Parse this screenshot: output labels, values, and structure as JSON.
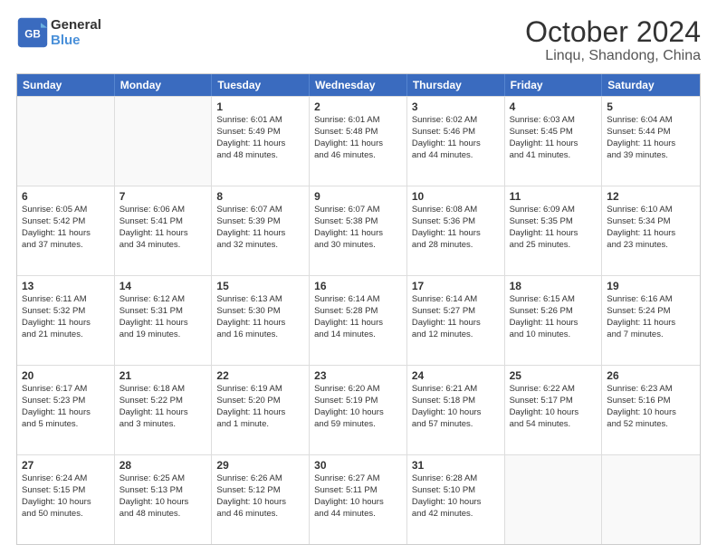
{
  "header": {
    "logo_line1": "General",
    "logo_line2": "Blue",
    "month": "October 2024",
    "location": "Linqu, Shandong, China"
  },
  "weekdays": [
    "Sunday",
    "Monday",
    "Tuesday",
    "Wednesday",
    "Thursday",
    "Friday",
    "Saturday"
  ],
  "rows": [
    [
      {
        "day": "",
        "lines": [],
        "empty": true
      },
      {
        "day": "",
        "lines": [],
        "empty": true
      },
      {
        "day": "1",
        "lines": [
          "Sunrise: 6:01 AM",
          "Sunset: 5:49 PM",
          "Daylight: 11 hours",
          "and 48 minutes."
        ]
      },
      {
        "day": "2",
        "lines": [
          "Sunrise: 6:01 AM",
          "Sunset: 5:48 PM",
          "Daylight: 11 hours",
          "and 46 minutes."
        ]
      },
      {
        "day": "3",
        "lines": [
          "Sunrise: 6:02 AM",
          "Sunset: 5:46 PM",
          "Daylight: 11 hours",
          "and 44 minutes."
        ]
      },
      {
        "day": "4",
        "lines": [
          "Sunrise: 6:03 AM",
          "Sunset: 5:45 PM",
          "Daylight: 11 hours",
          "and 41 minutes."
        ]
      },
      {
        "day": "5",
        "lines": [
          "Sunrise: 6:04 AM",
          "Sunset: 5:44 PM",
          "Daylight: 11 hours",
          "and 39 minutes."
        ]
      }
    ],
    [
      {
        "day": "6",
        "lines": [
          "Sunrise: 6:05 AM",
          "Sunset: 5:42 PM",
          "Daylight: 11 hours",
          "and 37 minutes."
        ]
      },
      {
        "day": "7",
        "lines": [
          "Sunrise: 6:06 AM",
          "Sunset: 5:41 PM",
          "Daylight: 11 hours",
          "and 34 minutes."
        ]
      },
      {
        "day": "8",
        "lines": [
          "Sunrise: 6:07 AM",
          "Sunset: 5:39 PM",
          "Daylight: 11 hours",
          "and 32 minutes."
        ]
      },
      {
        "day": "9",
        "lines": [
          "Sunrise: 6:07 AM",
          "Sunset: 5:38 PM",
          "Daylight: 11 hours",
          "and 30 minutes."
        ]
      },
      {
        "day": "10",
        "lines": [
          "Sunrise: 6:08 AM",
          "Sunset: 5:36 PM",
          "Daylight: 11 hours",
          "and 28 minutes."
        ]
      },
      {
        "day": "11",
        "lines": [
          "Sunrise: 6:09 AM",
          "Sunset: 5:35 PM",
          "Daylight: 11 hours",
          "and 25 minutes."
        ]
      },
      {
        "day": "12",
        "lines": [
          "Sunrise: 6:10 AM",
          "Sunset: 5:34 PM",
          "Daylight: 11 hours",
          "and 23 minutes."
        ]
      }
    ],
    [
      {
        "day": "13",
        "lines": [
          "Sunrise: 6:11 AM",
          "Sunset: 5:32 PM",
          "Daylight: 11 hours",
          "and 21 minutes."
        ]
      },
      {
        "day": "14",
        "lines": [
          "Sunrise: 6:12 AM",
          "Sunset: 5:31 PM",
          "Daylight: 11 hours",
          "and 19 minutes."
        ]
      },
      {
        "day": "15",
        "lines": [
          "Sunrise: 6:13 AM",
          "Sunset: 5:30 PM",
          "Daylight: 11 hours",
          "and 16 minutes."
        ]
      },
      {
        "day": "16",
        "lines": [
          "Sunrise: 6:14 AM",
          "Sunset: 5:28 PM",
          "Daylight: 11 hours",
          "and 14 minutes."
        ]
      },
      {
        "day": "17",
        "lines": [
          "Sunrise: 6:14 AM",
          "Sunset: 5:27 PM",
          "Daylight: 11 hours",
          "and 12 minutes."
        ]
      },
      {
        "day": "18",
        "lines": [
          "Sunrise: 6:15 AM",
          "Sunset: 5:26 PM",
          "Daylight: 11 hours",
          "and 10 minutes."
        ]
      },
      {
        "day": "19",
        "lines": [
          "Sunrise: 6:16 AM",
          "Sunset: 5:24 PM",
          "Daylight: 11 hours",
          "and 7 minutes."
        ]
      }
    ],
    [
      {
        "day": "20",
        "lines": [
          "Sunrise: 6:17 AM",
          "Sunset: 5:23 PM",
          "Daylight: 11 hours",
          "and 5 minutes."
        ]
      },
      {
        "day": "21",
        "lines": [
          "Sunrise: 6:18 AM",
          "Sunset: 5:22 PM",
          "Daylight: 11 hours",
          "and 3 minutes."
        ]
      },
      {
        "day": "22",
        "lines": [
          "Sunrise: 6:19 AM",
          "Sunset: 5:20 PM",
          "Daylight: 11 hours",
          "and 1 minute."
        ]
      },
      {
        "day": "23",
        "lines": [
          "Sunrise: 6:20 AM",
          "Sunset: 5:19 PM",
          "Daylight: 10 hours",
          "and 59 minutes."
        ]
      },
      {
        "day": "24",
        "lines": [
          "Sunrise: 6:21 AM",
          "Sunset: 5:18 PM",
          "Daylight: 10 hours",
          "and 57 minutes."
        ]
      },
      {
        "day": "25",
        "lines": [
          "Sunrise: 6:22 AM",
          "Sunset: 5:17 PM",
          "Daylight: 10 hours",
          "and 54 minutes."
        ]
      },
      {
        "day": "26",
        "lines": [
          "Sunrise: 6:23 AM",
          "Sunset: 5:16 PM",
          "Daylight: 10 hours",
          "and 52 minutes."
        ]
      }
    ],
    [
      {
        "day": "27",
        "lines": [
          "Sunrise: 6:24 AM",
          "Sunset: 5:15 PM",
          "Daylight: 10 hours",
          "and 50 minutes."
        ]
      },
      {
        "day": "28",
        "lines": [
          "Sunrise: 6:25 AM",
          "Sunset: 5:13 PM",
          "Daylight: 10 hours",
          "and 48 minutes."
        ]
      },
      {
        "day": "29",
        "lines": [
          "Sunrise: 6:26 AM",
          "Sunset: 5:12 PM",
          "Daylight: 10 hours",
          "and 46 minutes."
        ]
      },
      {
        "day": "30",
        "lines": [
          "Sunrise: 6:27 AM",
          "Sunset: 5:11 PM",
          "Daylight: 10 hours",
          "and 44 minutes."
        ]
      },
      {
        "day": "31",
        "lines": [
          "Sunrise: 6:28 AM",
          "Sunset: 5:10 PM",
          "Daylight: 10 hours",
          "and 42 minutes."
        ]
      },
      {
        "day": "",
        "lines": [],
        "empty": true
      },
      {
        "day": "",
        "lines": [],
        "empty": true
      }
    ]
  ]
}
